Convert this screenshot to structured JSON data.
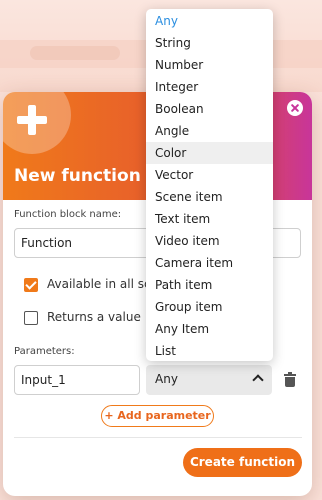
{
  "dialog": {
    "title": "New function",
    "function_name_label": "Function block name:",
    "function_name_value": "Function",
    "available_label": "Available in all scrip",
    "available_checked": true,
    "returns_label": "Returns a value",
    "returns_checked": false,
    "parameters_label": "Parameters:",
    "parameters": [
      {
        "name": "Input_1",
        "type": "Any"
      }
    ],
    "add_parameter_label": "Add parameter",
    "create_label": "Create function",
    "accent_color": "#f07a1a"
  },
  "dropdown": {
    "selected": "Any",
    "hovered": "Color",
    "options": [
      "Any",
      "String",
      "Number",
      "Integer",
      "Boolean",
      "Angle",
      "Color",
      "Vector",
      "Scene item",
      "Text item",
      "Video item",
      "Camera item",
      "Path item",
      "Group item",
      "Any Item",
      "List"
    ]
  }
}
